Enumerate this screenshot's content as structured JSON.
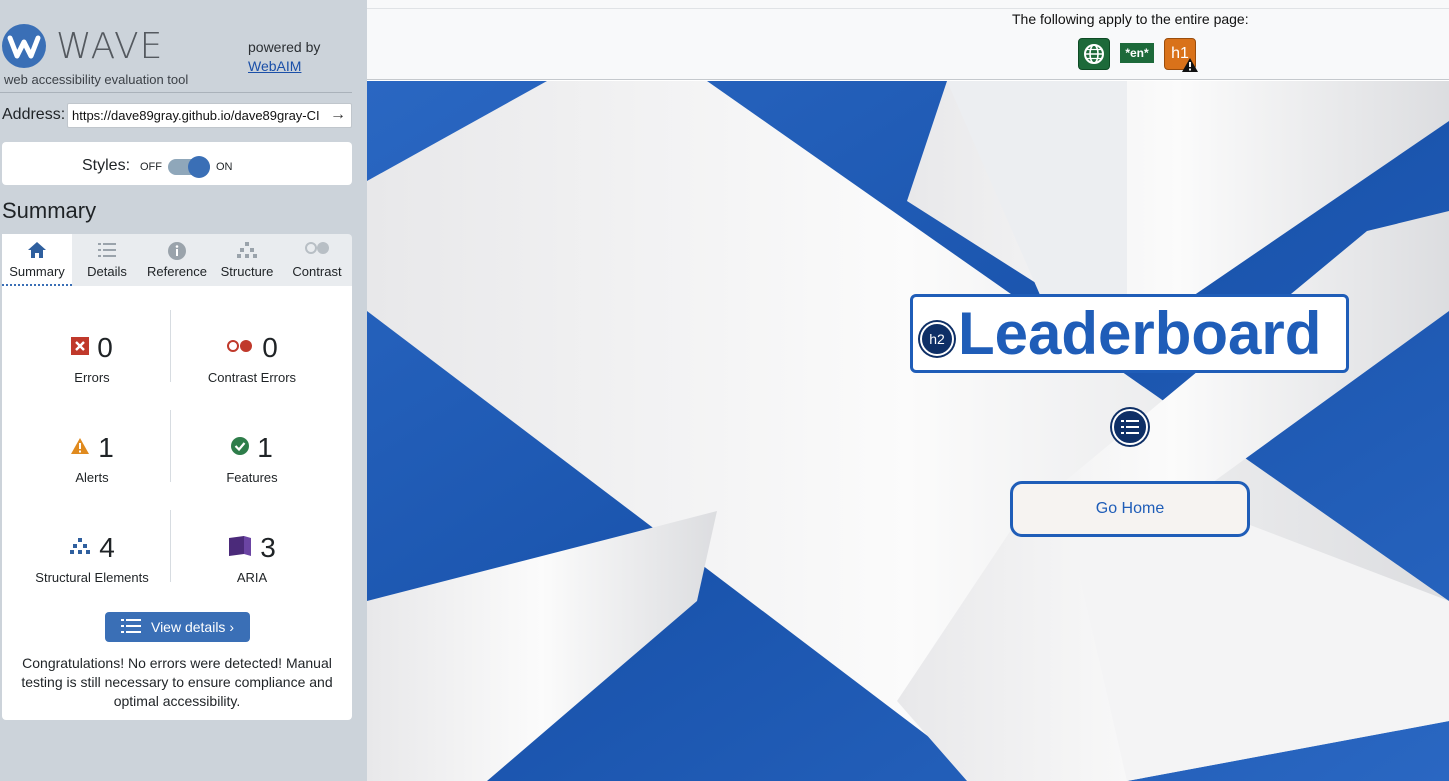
{
  "app": {
    "logo_text": "WAVE",
    "subtitle": "web accessibility evaluation tool",
    "powered_by": "powered by",
    "webaim_link": "WebAIM"
  },
  "address": {
    "label": "Address:",
    "value": "https://dave89gray.github.io/dave89gray-CI"
  },
  "styles": {
    "label": "Styles:",
    "off": "OFF",
    "on": "ON",
    "enabled": true
  },
  "summary": {
    "heading": "Summary",
    "tabs": [
      {
        "label": "Summary",
        "icon": "home-icon",
        "active": true
      },
      {
        "label": "Details",
        "icon": "list-icon",
        "active": false
      },
      {
        "label": "Reference",
        "icon": "info-icon",
        "active": false
      },
      {
        "label": "Structure",
        "icon": "structure-icon",
        "active": false
      },
      {
        "label": "Contrast",
        "icon": "contrast-icon",
        "active": false
      }
    ],
    "stats": {
      "errors": {
        "count": "0",
        "label": "Errors"
      },
      "contrast_errors": {
        "count": "0",
        "label": "Contrast Errors"
      },
      "alerts": {
        "count": "1",
        "label": "Alerts"
      },
      "features": {
        "count": "1",
        "label": "Features"
      },
      "structural": {
        "count": "4",
        "label": "Structural Elements"
      },
      "aria": {
        "count": "3",
        "label": "ARIA"
      }
    },
    "view_details": "View details ›",
    "congrats": "Congratulations! No errors were detected! Manual testing is still necessary to ensure compliance and optimal accessibility."
  },
  "page": {
    "apply_text": "The following apply to the entire page:",
    "lang_badge": "*en*",
    "h1_badge": "h1",
    "h2_badge": "h2",
    "heading": "Leaderboard",
    "button": "Go Home"
  },
  "colors": {
    "accent": "#3a6fb6",
    "flag_blue": "#1f5db8",
    "error_red": "#c0392b",
    "alert_orange": "#e08a1e",
    "feature_green": "#2e7d4a",
    "aria_purple": "#4b2a7a"
  }
}
